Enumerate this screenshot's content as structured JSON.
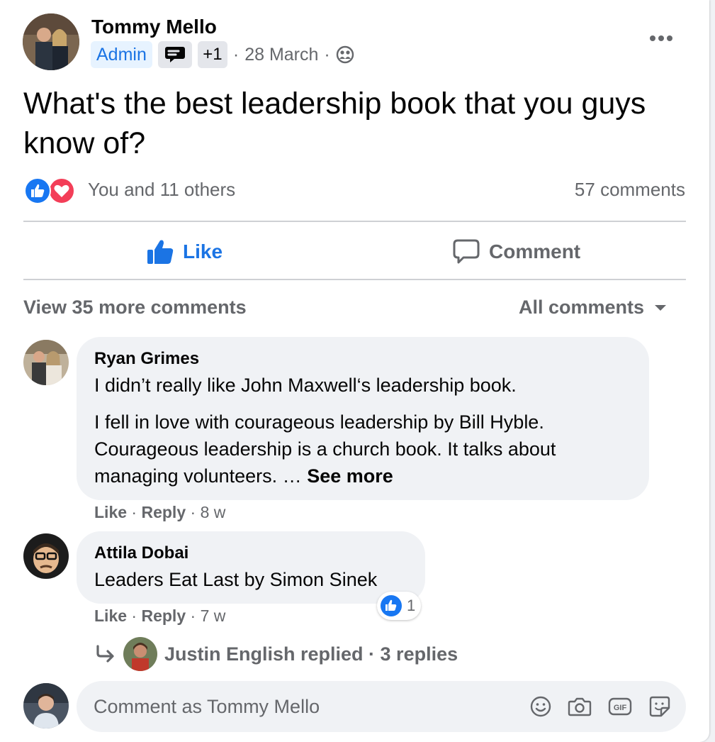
{
  "post": {
    "author": "Tommy Mello",
    "badges": {
      "admin": "Admin",
      "extra": "+1"
    },
    "date": "28 March",
    "separator": "·",
    "text": "What's the best leadership book that you guys know of?",
    "reactions_text": "You and 11 others",
    "comments_count": "57 comments",
    "privacy_icon": "group-icon"
  },
  "actions": {
    "like": "Like",
    "comment": "Comment"
  },
  "comments_header": {
    "view_more": "View 35 more comments",
    "filter": "All comments"
  },
  "comments": [
    {
      "author": "Ryan Grimes",
      "line1": "I didn’t really like John Maxwell‘s leadership book.",
      "line2": "I fell in love with courageous leadership by Bill Hyble. Courageous leadership is a church book. It talks about managing volunteers. …",
      "see_more": "See more",
      "like": "Like",
      "reply": "Reply",
      "time": "8 w"
    },
    {
      "author": "Attila Dobai",
      "text": "Leaders Eat Last by Simon Sinek",
      "like": "Like",
      "reply": "Reply",
      "time": "7 w",
      "reaction_count": "1",
      "replies_summary": "Justin English replied · 3 replies"
    }
  ],
  "composer": {
    "placeholder": "Comment as Tommy Mello"
  },
  "colors": {
    "accent": "#1b74e4",
    "like_blue": "#1877f2",
    "love_red": "#f33e58",
    "secondary_text": "#65676b"
  }
}
